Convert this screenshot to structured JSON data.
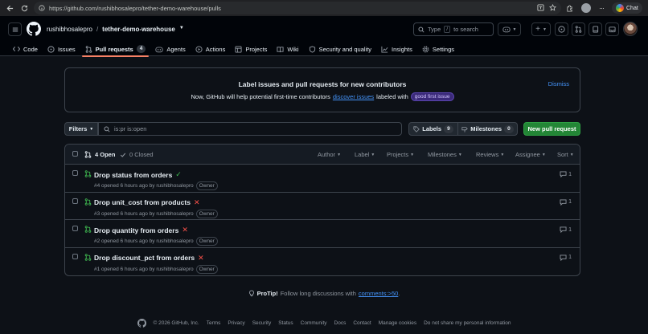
{
  "browser": {
    "url": "https://github.com/rushibhosalepro/tether-demo-warehouse/pulls",
    "chat_label": "Chat"
  },
  "header": {
    "owner": "rushibhosalepro",
    "separator": "/",
    "repo": "tether-demo-warehouse",
    "search_placeholder": "Type / to search",
    "search_key": "/",
    "search_prefix": "Type",
    "search_suffix": "to search"
  },
  "tabs": [
    {
      "label": "Code",
      "icon": "code-icon"
    },
    {
      "label": "Issues",
      "icon": "issue-opened-icon"
    },
    {
      "label": "Pull requests",
      "icon": "git-pull-request-icon",
      "count": "4",
      "active": true
    },
    {
      "label": "Agents",
      "icon": "agent-icon"
    },
    {
      "label": "Actions",
      "icon": "play-icon"
    },
    {
      "label": "Projects",
      "icon": "table-icon"
    },
    {
      "label": "Wiki",
      "icon": "book-icon"
    },
    {
      "label": "Security and quality",
      "icon": "shield-icon"
    },
    {
      "label": "Insights",
      "icon": "graph-icon"
    },
    {
      "label": "Settings",
      "icon": "gear-icon"
    }
  ],
  "banner": {
    "title": "Label issues and pull requests for new contributors",
    "subtitle_before": "Now, GitHub will help potential first-time contributors",
    "subtitle_link": "discover issues",
    "subtitle_after": "labeled with",
    "label": "good first issue",
    "dismiss": "Dismiss"
  },
  "filterbar": {
    "filters_label": "Filters",
    "query": "is:pr is:open",
    "labels_label": "Labels",
    "labels_count": "9",
    "milestones_label": "Milestones",
    "milestones_count": "0",
    "new_pr_label": "New pull request"
  },
  "list_header": {
    "open_label": "4 Open",
    "closed_label": "0 Closed",
    "sorts": [
      "Author",
      "Label",
      "Projects",
      "Milestones",
      "Reviews",
      "Assignee",
      "Sort"
    ]
  },
  "pull_requests": [
    {
      "title": "Drop status from orders",
      "status": "success",
      "meta": "#4 opened 6 hours ago by rushibhosalepro",
      "badge": "Owner",
      "comments": "1"
    },
    {
      "title": "Drop unit_cost from products",
      "status": "failure",
      "meta": "#3 opened 6 hours ago by rushibhosalepro",
      "badge": "Owner",
      "comments": "1"
    },
    {
      "title": "Drop quantity from orders",
      "status": "failure",
      "meta": "#2 opened 6 hours ago by rushibhosalepro",
      "badge": "Owner",
      "comments": "1"
    },
    {
      "title": "Drop discount_pct from orders",
      "status": "failure",
      "meta": "#1 opened 6 hours ago by rushibhosalepro",
      "badge": "Owner",
      "comments": "1"
    }
  ],
  "protip": {
    "label": "ProTip!",
    "text": "Follow long discussions with",
    "link": "comments:>50",
    "end": "."
  },
  "footer": {
    "copyright": "© 2026 GitHub, Inc.",
    "links": [
      "Terms",
      "Privacy",
      "Security",
      "Status",
      "Community",
      "Docs",
      "Contact",
      "Manage cookies",
      "Do not share my personal information"
    ]
  },
  "colors": {
    "accent_link": "#4493f8",
    "success": "#3fb950",
    "danger": "#f85149",
    "primary_button": "#238636",
    "tab_underline": "#f78166"
  }
}
